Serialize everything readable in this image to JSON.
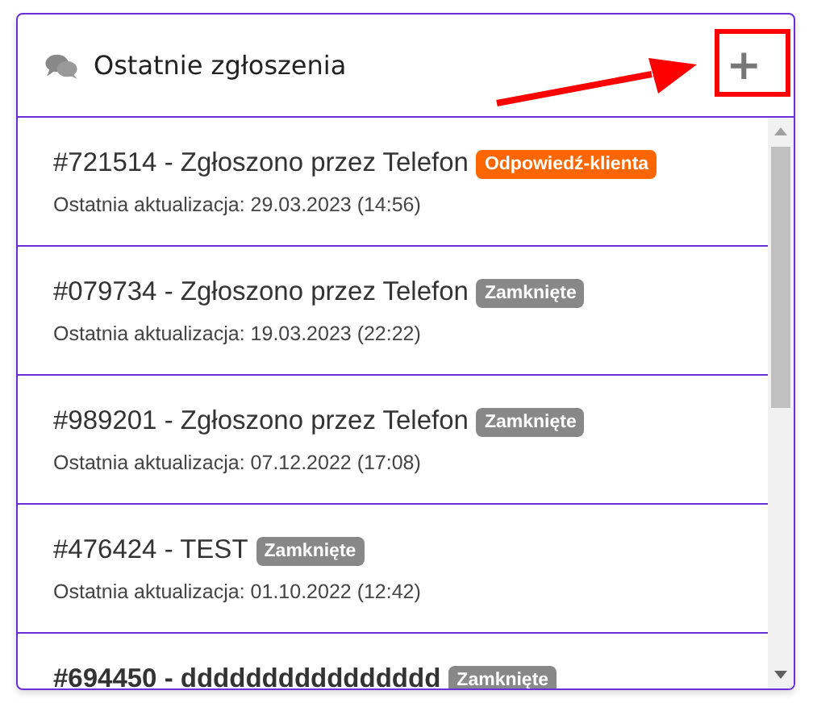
{
  "panel": {
    "title": "Ostatnie zgłoszenia",
    "add_button": "+"
  },
  "annotation": {
    "arrow": true,
    "highlight_box": true
  },
  "tickets": [
    {
      "title": "#721514 - Zgłoszono przez Telefon",
      "status": "Odpowiedź-klienta",
      "color": "#ff6600",
      "unread": false,
      "updated": "Ostatnia aktualizacja: 29.03.2023 (14:56)"
    },
    {
      "title": "#079734 - Zgłoszono przez Telefon",
      "status": "Zamknięte",
      "color": "#888888",
      "unread": false,
      "updated": "Ostatnia aktualizacja: 19.03.2023 (22:22)"
    },
    {
      "title": "#989201 - Zgłoszono przez Telefon",
      "status": "Zamknięte",
      "color": "#888888",
      "unread": false,
      "updated": "Ostatnia aktualizacja: 07.12.2022 (17:08)"
    },
    {
      "title": "#476424 - TEST",
      "status": "Zamknięte",
      "color": "#888888",
      "unread": false,
      "updated": "Ostatnia aktualizacja: 01.10.2022 (12:42)"
    },
    {
      "title": "#694450 - dddddddddddddddd",
      "status": "Zamknięte",
      "color": "#888888",
      "unread": true
    }
  ]
}
